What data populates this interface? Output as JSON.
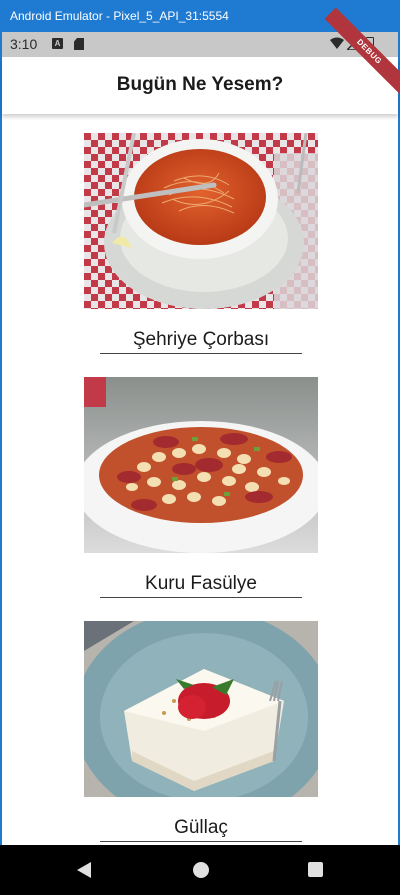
{
  "window": {
    "title": "Android Emulator - Pixel_5_API_31:5554"
  },
  "status_bar": {
    "time": "3:10",
    "notif_icon_letter": "A",
    "icons": [
      "android-icon",
      "sd-card-icon",
      "wifi-icon",
      "signal-icon",
      "battery-icon"
    ]
  },
  "debug_banner": "DEBUG",
  "app_bar": {
    "title": "Bugün Ne Yesem?"
  },
  "foods": [
    {
      "name": "Şehriye Çorbası",
      "image": "noodle-soup-image"
    },
    {
      "name": "Kuru Fasülye",
      "image": "bean-stew-image"
    },
    {
      "name": "Güllaç",
      "image": "gullac-dessert-image"
    }
  ],
  "nav_bar": {
    "buttons": [
      "back-icon",
      "home-icon",
      "recents-icon"
    ]
  },
  "colors": {
    "window_accent": "#1f7ad1",
    "status_bar": "#c8c8c8",
    "debug_ribbon": "#b0353c",
    "nav_bar": "#000000"
  }
}
